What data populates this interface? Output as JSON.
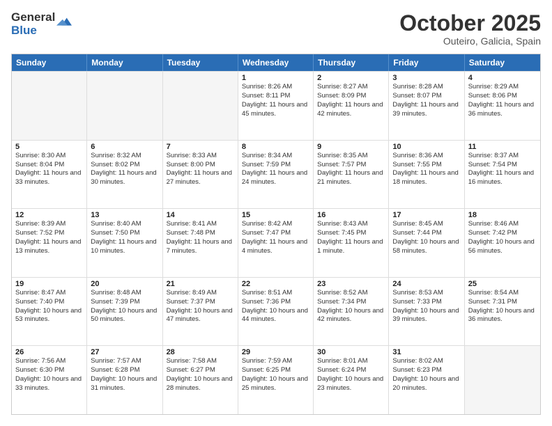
{
  "logo": {
    "general": "General",
    "blue": "Blue"
  },
  "title": "October 2025",
  "location": "Outeiro, Galicia, Spain",
  "header_days": [
    "Sunday",
    "Monday",
    "Tuesday",
    "Wednesday",
    "Thursday",
    "Friday",
    "Saturday"
  ],
  "weeks": [
    [
      {
        "day": "",
        "sunrise": "",
        "sunset": "",
        "daylight": "",
        "empty": true
      },
      {
        "day": "",
        "sunrise": "",
        "sunset": "",
        "daylight": "",
        "empty": true
      },
      {
        "day": "",
        "sunrise": "",
        "sunset": "",
        "daylight": "",
        "empty": true
      },
      {
        "day": "1",
        "sunrise": "Sunrise: 8:26 AM",
        "sunset": "Sunset: 8:11 PM",
        "daylight": "Daylight: 11 hours and 45 minutes.",
        "empty": false
      },
      {
        "day": "2",
        "sunrise": "Sunrise: 8:27 AM",
        "sunset": "Sunset: 8:09 PM",
        "daylight": "Daylight: 11 hours and 42 minutes.",
        "empty": false
      },
      {
        "day": "3",
        "sunrise": "Sunrise: 8:28 AM",
        "sunset": "Sunset: 8:07 PM",
        "daylight": "Daylight: 11 hours and 39 minutes.",
        "empty": false
      },
      {
        "day": "4",
        "sunrise": "Sunrise: 8:29 AM",
        "sunset": "Sunset: 8:06 PM",
        "daylight": "Daylight: 11 hours and 36 minutes.",
        "empty": false
      }
    ],
    [
      {
        "day": "5",
        "sunrise": "Sunrise: 8:30 AM",
        "sunset": "Sunset: 8:04 PM",
        "daylight": "Daylight: 11 hours and 33 minutes.",
        "empty": false
      },
      {
        "day": "6",
        "sunrise": "Sunrise: 8:32 AM",
        "sunset": "Sunset: 8:02 PM",
        "daylight": "Daylight: 11 hours and 30 minutes.",
        "empty": false
      },
      {
        "day": "7",
        "sunrise": "Sunrise: 8:33 AM",
        "sunset": "Sunset: 8:00 PM",
        "daylight": "Daylight: 11 hours and 27 minutes.",
        "empty": false
      },
      {
        "day": "8",
        "sunrise": "Sunrise: 8:34 AM",
        "sunset": "Sunset: 7:59 PM",
        "daylight": "Daylight: 11 hours and 24 minutes.",
        "empty": false
      },
      {
        "day": "9",
        "sunrise": "Sunrise: 8:35 AM",
        "sunset": "Sunset: 7:57 PM",
        "daylight": "Daylight: 11 hours and 21 minutes.",
        "empty": false
      },
      {
        "day": "10",
        "sunrise": "Sunrise: 8:36 AM",
        "sunset": "Sunset: 7:55 PM",
        "daylight": "Daylight: 11 hours and 18 minutes.",
        "empty": false
      },
      {
        "day": "11",
        "sunrise": "Sunrise: 8:37 AM",
        "sunset": "Sunset: 7:54 PM",
        "daylight": "Daylight: 11 hours and 16 minutes.",
        "empty": false
      }
    ],
    [
      {
        "day": "12",
        "sunrise": "Sunrise: 8:39 AM",
        "sunset": "Sunset: 7:52 PM",
        "daylight": "Daylight: 11 hours and 13 minutes.",
        "empty": false
      },
      {
        "day": "13",
        "sunrise": "Sunrise: 8:40 AM",
        "sunset": "Sunset: 7:50 PM",
        "daylight": "Daylight: 11 hours and 10 minutes.",
        "empty": false
      },
      {
        "day": "14",
        "sunrise": "Sunrise: 8:41 AM",
        "sunset": "Sunset: 7:48 PM",
        "daylight": "Daylight: 11 hours and 7 minutes.",
        "empty": false
      },
      {
        "day": "15",
        "sunrise": "Sunrise: 8:42 AM",
        "sunset": "Sunset: 7:47 PM",
        "daylight": "Daylight: 11 hours and 4 minutes.",
        "empty": false
      },
      {
        "day": "16",
        "sunrise": "Sunrise: 8:43 AM",
        "sunset": "Sunset: 7:45 PM",
        "daylight": "Daylight: 11 hours and 1 minute.",
        "empty": false
      },
      {
        "day": "17",
        "sunrise": "Sunrise: 8:45 AM",
        "sunset": "Sunset: 7:44 PM",
        "daylight": "Daylight: 10 hours and 58 minutes.",
        "empty": false
      },
      {
        "day": "18",
        "sunrise": "Sunrise: 8:46 AM",
        "sunset": "Sunset: 7:42 PM",
        "daylight": "Daylight: 10 hours and 56 minutes.",
        "empty": false
      }
    ],
    [
      {
        "day": "19",
        "sunrise": "Sunrise: 8:47 AM",
        "sunset": "Sunset: 7:40 PM",
        "daylight": "Daylight: 10 hours and 53 minutes.",
        "empty": false
      },
      {
        "day": "20",
        "sunrise": "Sunrise: 8:48 AM",
        "sunset": "Sunset: 7:39 PM",
        "daylight": "Daylight: 10 hours and 50 minutes.",
        "empty": false
      },
      {
        "day": "21",
        "sunrise": "Sunrise: 8:49 AM",
        "sunset": "Sunset: 7:37 PM",
        "daylight": "Daylight: 10 hours and 47 minutes.",
        "empty": false
      },
      {
        "day": "22",
        "sunrise": "Sunrise: 8:51 AM",
        "sunset": "Sunset: 7:36 PM",
        "daylight": "Daylight: 10 hours and 44 minutes.",
        "empty": false
      },
      {
        "day": "23",
        "sunrise": "Sunrise: 8:52 AM",
        "sunset": "Sunset: 7:34 PM",
        "daylight": "Daylight: 10 hours and 42 minutes.",
        "empty": false
      },
      {
        "day": "24",
        "sunrise": "Sunrise: 8:53 AM",
        "sunset": "Sunset: 7:33 PM",
        "daylight": "Daylight: 10 hours and 39 minutes.",
        "empty": false
      },
      {
        "day": "25",
        "sunrise": "Sunrise: 8:54 AM",
        "sunset": "Sunset: 7:31 PM",
        "daylight": "Daylight: 10 hours and 36 minutes.",
        "empty": false
      }
    ],
    [
      {
        "day": "26",
        "sunrise": "Sunrise: 7:56 AM",
        "sunset": "Sunset: 6:30 PM",
        "daylight": "Daylight: 10 hours and 33 minutes.",
        "empty": false
      },
      {
        "day": "27",
        "sunrise": "Sunrise: 7:57 AM",
        "sunset": "Sunset: 6:28 PM",
        "daylight": "Daylight: 10 hours and 31 minutes.",
        "empty": false
      },
      {
        "day": "28",
        "sunrise": "Sunrise: 7:58 AM",
        "sunset": "Sunset: 6:27 PM",
        "daylight": "Daylight: 10 hours and 28 minutes.",
        "empty": false
      },
      {
        "day": "29",
        "sunrise": "Sunrise: 7:59 AM",
        "sunset": "Sunset: 6:25 PM",
        "daylight": "Daylight: 10 hours and 25 minutes.",
        "empty": false
      },
      {
        "day": "30",
        "sunrise": "Sunrise: 8:01 AM",
        "sunset": "Sunset: 6:24 PM",
        "daylight": "Daylight: 10 hours and 23 minutes.",
        "empty": false
      },
      {
        "day": "31",
        "sunrise": "Sunrise: 8:02 AM",
        "sunset": "Sunset: 6:23 PM",
        "daylight": "Daylight: 10 hours and 20 minutes.",
        "empty": false
      },
      {
        "day": "",
        "sunrise": "",
        "sunset": "",
        "daylight": "",
        "empty": true
      }
    ]
  ]
}
